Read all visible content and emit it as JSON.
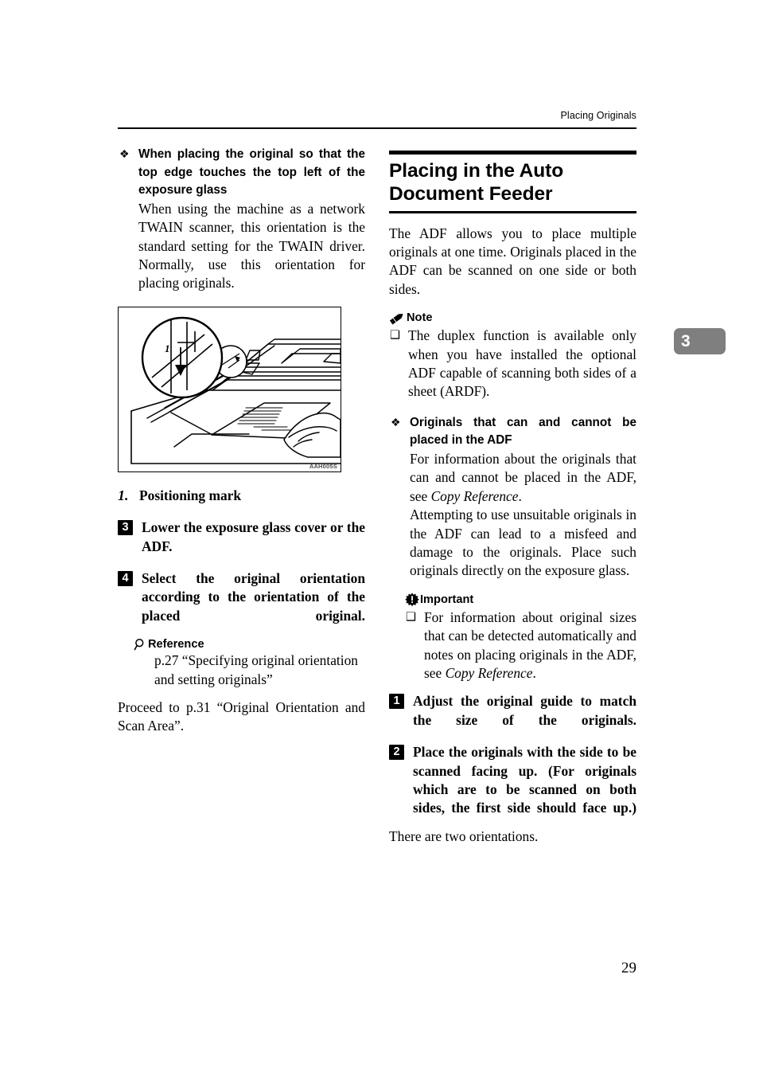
{
  "header": {
    "running_title": "Placing Originals"
  },
  "chapter_tab": {
    "label": "3"
  },
  "page_number": "29",
  "left_column": {
    "keypoint": {
      "bullet": "❖",
      "title": "When placing the original so that the top edge touches the top left of the exposure glass",
      "body": "When using the machine as a network TWAIN scanner, this orientation is the standard setting for the TWAIN driver. Normally, use this orientation for placing originals."
    },
    "figure": {
      "id_label": "AAH005S",
      "alt": "Illustration of an original being placed on the exposure glass with a magnified detail circle showing the positioning mark"
    },
    "legend": {
      "number": "1.",
      "text": "Positioning mark"
    },
    "steps": [
      {
        "number": "3",
        "text": "Lower the exposure glass cover or the ADF."
      },
      {
        "number": "4",
        "text": "Select the original orientation according to the orientation of the placed original."
      }
    ],
    "reference": {
      "icon": "magnifier-icon",
      "label": "Reference",
      "body": "p.27 “Specifying original orientation and setting originals”"
    },
    "proceed_text": "Proceed to p.31 “Original Orientation and Scan Area”."
  },
  "right_column": {
    "section_title": "Placing in the Auto Document Feeder",
    "intro": "The ADF allows you to place multiple originals at one time. Originals placed in the ADF can be scanned on one side or both sides.",
    "note": {
      "icon": "pencil-icon",
      "label": "Note",
      "bullet": "❑",
      "items": [
        "The duplex function is available only when you have installed the optional ADF capable of scanning both sides of a sheet (ARDF)."
      ]
    },
    "keypoint": {
      "bullet": "❖",
      "title": "Originals that can and cannot be placed in the ADF",
      "body_part1": "For information about the originals that can and cannot be placed in the ADF, see ",
      "body_italic1": "Copy Reference",
      "body_part2": ".",
      "body_part3": "Attempting to use unsuitable originals in the ADF can lead to a misfeed and damage to the originals. Place such originals directly on the exposure glass."
    },
    "important": {
      "icon": "important-starburst-icon",
      "label": "Important",
      "bullet": "❑",
      "item_part1": "For information about original sizes that can be detected automatically and notes on placing originals in the ADF, see ",
      "item_italic": "Copy Reference",
      "item_part2": "."
    },
    "steps": [
      {
        "number": "1",
        "text": "Adjust the original guide to match the size of the originals."
      },
      {
        "number": "2",
        "text": "Place the originals with the side to be scanned facing up. (For originals which are to be scanned on both sides, the first side should face up.)"
      }
    ],
    "closing_text": "There are two orientations."
  }
}
